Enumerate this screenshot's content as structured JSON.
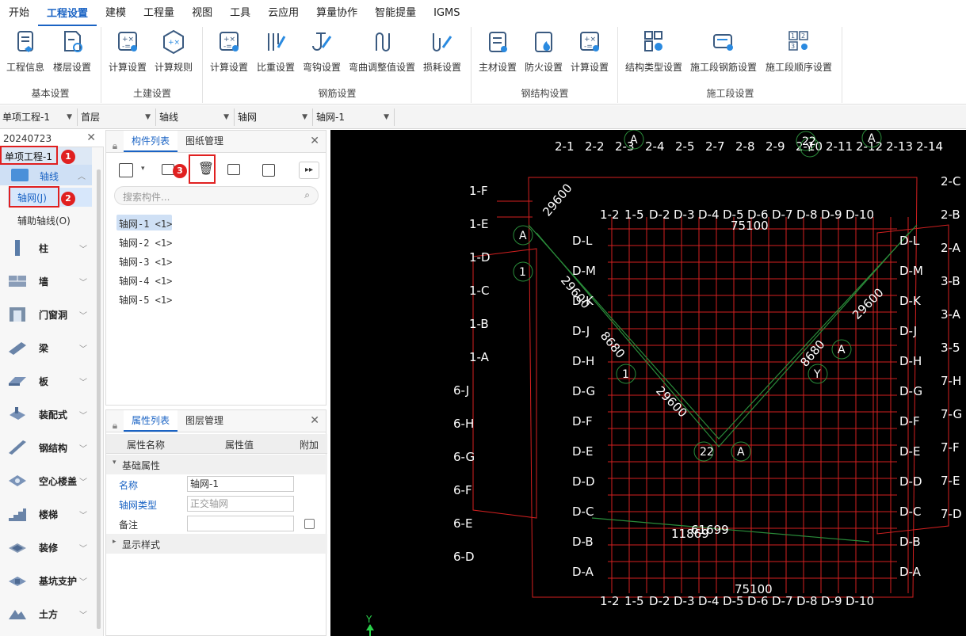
{
  "menu": [
    "开始",
    "工程设置",
    "建模",
    "工程量",
    "视图",
    "工具",
    "云应用",
    "算量协作",
    "智能提量",
    "IGMS"
  ],
  "menu_active_index": 1,
  "ribbon": {
    "groups": [
      {
        "title": "基本设置",
        "buttons": [
          "工程信息",
          "楼层设置"
        ]
      },
      {
        "title": "土建设置",
        "buttons": [
          "计算设置",
          "计算规则"
        ]
      },
      {
        "title": "钢筋设置",
        "buttons": [
          "计算设置",
          "比重设置",
          "弯钩设置",
          "弯曲调整值设置",
          "损耗设置"
        ]
      },
      {
        "title": "钢结构设置",
        "buttons": [
          "主材设置",
          "防火设置",
          "计算设置"
        ]
      },
      {
        "title": "施工段设置",
        "buttons": [
          "结构类型设置",
          "施工段钢筋设置",
          "施工段顺序设置"
        ]
      }
    ]
  },
  "selectors": [
    "单项工程-1",
    "首层",
    "轴线",
    "轴网",
    "轴网-1"
  ],
  "left": {
    "project_date": "20240723",
    "project_name": "单项工程-1",
    "axis_group": "轴线",
    "axis_items": [
      "轴网(J)",
      "辅助轴线(O)"
    ],
    "nav": [
      "柱",
      "墙",
      "门窗洞",
      "梁",
      "板",
      "装配式",
      "钢结构",
      "空心楼盖",
      "楼梯",
      "装修",
      "基坑支护",
      "土方"
    ]
  },
  "component_panel": {
    "tabs": [
      "构件列表",
      "图纸管理"
    ],
    "search_placeholder": "搜索构件...",
    "items": [
      "轴网-1 <1>",
      "轴网-2 <1>",
      "轴网-3 <1>",
      "轴网-4 <1>",
      "轴网-5 <1>"
    ]
  },
  "property_panel": {
    "tabs": [
      "属性列表",
      "图层管理"
    ],
    "headers": [
      "属性名称",
      "属性值",
      "附加"
    ],
    "section_basic": "基础属性",
    "rows": [
      {
        "name": "名称",
        "value": "轴网-1"
      },
      {
        "name": "轴网类型",
        "value": "正交轴网"
      },
      {
        "name": "备注",
        "value": ""
      }
    ],
    "section_display": "显示样式"
  },
  "badges": [
    "1",
    "2",
    "3"
  ],
  "canvas": {
    "top_axis_labels": [
      "2-1",
      "2-2",
      "2-3",
      "2-4",
      "2-5",
      "2-7",
      "2-8",
      "2-9",
      "2-10",
      "2-11",
      "2-12",
      "2-13",
      "2-14"
    ],
    "inner_top_labels": [
      "1-2",
      "1-5",
      "D-2",
      "D-3",
      "D-4",
      "D-5",
      "D-6",
      "D-7",
      "D-8",
      "D-9",
      "D-10"
    ],
    "bottom_labels": [
      "1-2",
      "1-5",
      "D-2",
      "D-3",
      "D-4",
      "D-5",
      "D-6",
      "D-7",
      "D-8",
      "D-9",
      "D-10"
    ],
    "left_labels": [
      "1-F",
      "1-E",
      "1-D",
      "1-C",
      "1-B",
      "1-A",
      "6-J",
      "6-H",
      "6-G",
      "6-F",
      "6-E",
      "6-D"
    ],
    "inner_left_labels": [
      "D-L",
      "D-M",
      "D-K",
      "D-J",
      "D-H",
      "D-G",
      "D-F",
      "D-E",
      "D-D",
      "D-C",
      "D-B",
      "D-A"
    ],
    "right_labels": [
      "2-C",
      "2-B",
      "2-A",
      "3-B",
      "3-A",
      "3-5",
      "7-H",
      "7-G",
      "7-F",
      "7-E",
      "7-D"
    ],
    "inner_right_labels": [
      "D-L",
      "D-M",
      "D-K",
      "D-J",
      "D-H",
      "D-G",
      "D-F",
      "D-E",
      "D-D",
      "D-C",
      "D-B",
      "D-A"
    ],
    "dims": [
      "29600",
      "29600",
      "29600",
      "29600",
      "8680",
      "8680",
      "75100",
      "75100",
      "61699",
      "11869"
    ],
    "circle_labels": [
      "A",
      "1",
      "A",
      "1",
      "22",
      "A",
      "Y",
      "A",
      "A",
      "Y",
      "22"
    ],
    "cursor_label": "Y"
  }
}
